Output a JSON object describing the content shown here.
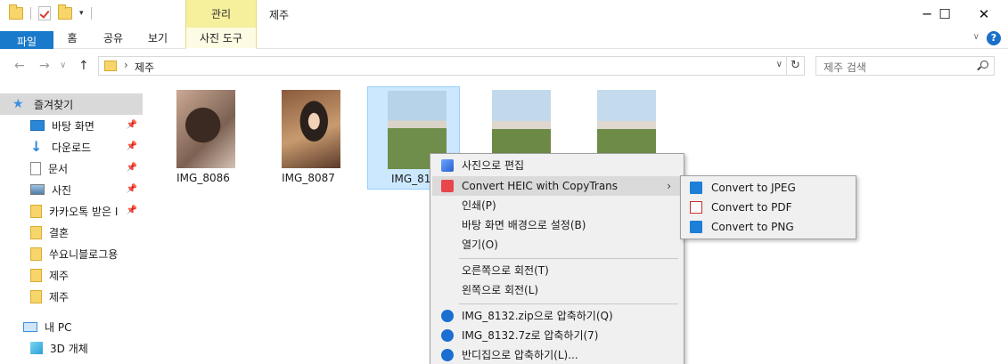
{
  "window": {
    "title": "제주",
    "context_tab_header": "관리",
    "controls": {
      "minimize": "─",
      "maximize": "☐",
      "close": "✕"
    }
  },
  "ribbon": {
    "tabs": [
      "파일",
      "홈",
      "공유",
      "보기"
    ],
    "context_tab": "사진 도구",
    "help": "?"
  },
  "address": {
    "path": "제주",
    "search_placeholder": "제주 검색"
  },
  "sidebar": {
    "items": [
      {
        "label": "즐겨찾기",
        "icon": "star-icon",
        "pinned": false,
        "selected": true
      },
      {
        "label": "바탕 화면",
        "icon": "desktop-icon",
        "pinned": true
      },
      {
        "label": "다운로드",
        "icon": "download-arrow-icon",
        "pinned": true
      },
      {
        "label": "문서",
        "icon": "document-icon",
        "pinned": true
      },
      {
        "label": "사진",
        "icon": "pictures-icon",
        "pinned": true
      },
      {
        "label": "카카오톡 받은 I",
        "icon": "folder-icon",
        "pinned": true
      },
      {
        "label": "결혼",
        "icon": "folder-icon",
        "pinned": false
      },
      {
        "label": "쑤요니블로그용",
        "icon": "folder-icon",
        "pinned": false
      },
      {
        "label": "제주",
        "icon": "folder-icon",
        "pinned": false
      },
      {
        "label": "제주",
        "icon": "folder-icon",
        "pinned": false
      },
      {
        "label": "내 PC",
        "icon": "pc-icon",
        "pinned": false
      },
      {
        "label": "3D 개체",
        "icon": "cube-icon",
        "pinned": false
      }
    ]
  },
  "files": [
    {
      "name": "IMG_8086",
      "selected": false
    },
    {
      "name": "IMG_8087",
      "selected": false
    },
    {
      "name": "IMG_813",
      "selected": true
    },
    {
      "name": "",
      "selected": false
    },
    {
      "name": "",
      "selected": false
    }
  ],
  "context_menu": {
    "items": [
      {
        "label": "사진으로 편집",
        "icon": "photos-edit-icon"
      },
      {
        "label": "Convert HEIC with CopyTrans",
        "icon": "copytrans-heic-icon",
        "submenu": true,
        "highlighted": true
      },
      {
        "label": "인쇄(P)"
      },
      {
        "label": "바탕 화면 배경으로 설정(B)"
      },
      {
        "label": "열기(O)"
      },
      {
        "label": "오른쪽으로 회전(T)"
      },
      {
        "label": "왼쪽으로 회전(L)"
      },
      {
        "label": "IMG_8132.zip으로 압축하기(Q)",
        "icon": "bandizip-icon"
      },
      {
        "label": "IMG_8132.7z로 압축하기(7)",
        "icon": "bandizip-icon"
      },
      {
        "label": "반디집으로 압축하기(L)...",
        "icon": "bandizip-icon"
      }
    ]
  },
  "submenu": {
    "items": [
      {
        "label": "Convert to JPEG",
        "icon": "jpeg-image-icon"
      },
      {
        "label": "Convert to PDF",
        "icon": "pdf-icon"
      },
      {
        "label": "Convert to PNG",
        "icon": "png-image-icon"
      }
    ]
  },
  "colors": {
    "file_tab": "#1979ca",
    "context_tab": "#f6ef9c",
    "selection": "#cce8ff",
    "menu_bg": "#f0f0f0"
  }
}
